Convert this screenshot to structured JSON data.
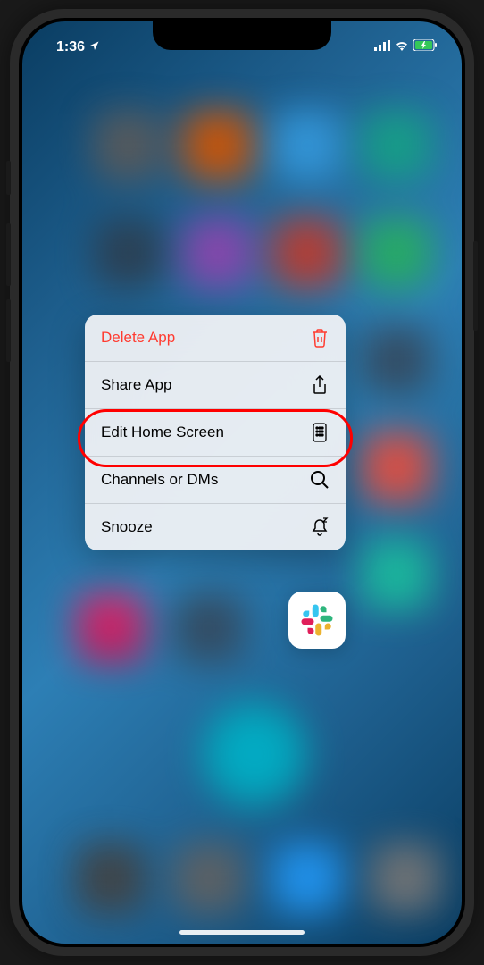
{
  "statusBar": {
    "time": "1:36",
    "locationIcon": "location-arrow"
  },
  "contextMenu": {
    "items": [
      {
        "label": "Delete App",
        "icon": "trash",
        "destructive": true
      },
      {
        "label": "Share App",
        "icon": "share"
      },
      {
        "label": "Edit Home Screen",
        "icon": "apps-grid",
        "highlighted": true
      },
      {
        "label": "Channels or DMs",
        "icon": "search"
      },
      {
        "label": "Snooze",
        "icon": "bell-snooze"
      }
    ]
  },
  "appIcon": {
    "name": "Slack"
  },
  "colors": {
    "destructive": "#ff3b30",
    "highlight": "#ff0000",
    "menuBg": "rgba(245,245,247,0.92)"
  }
}
